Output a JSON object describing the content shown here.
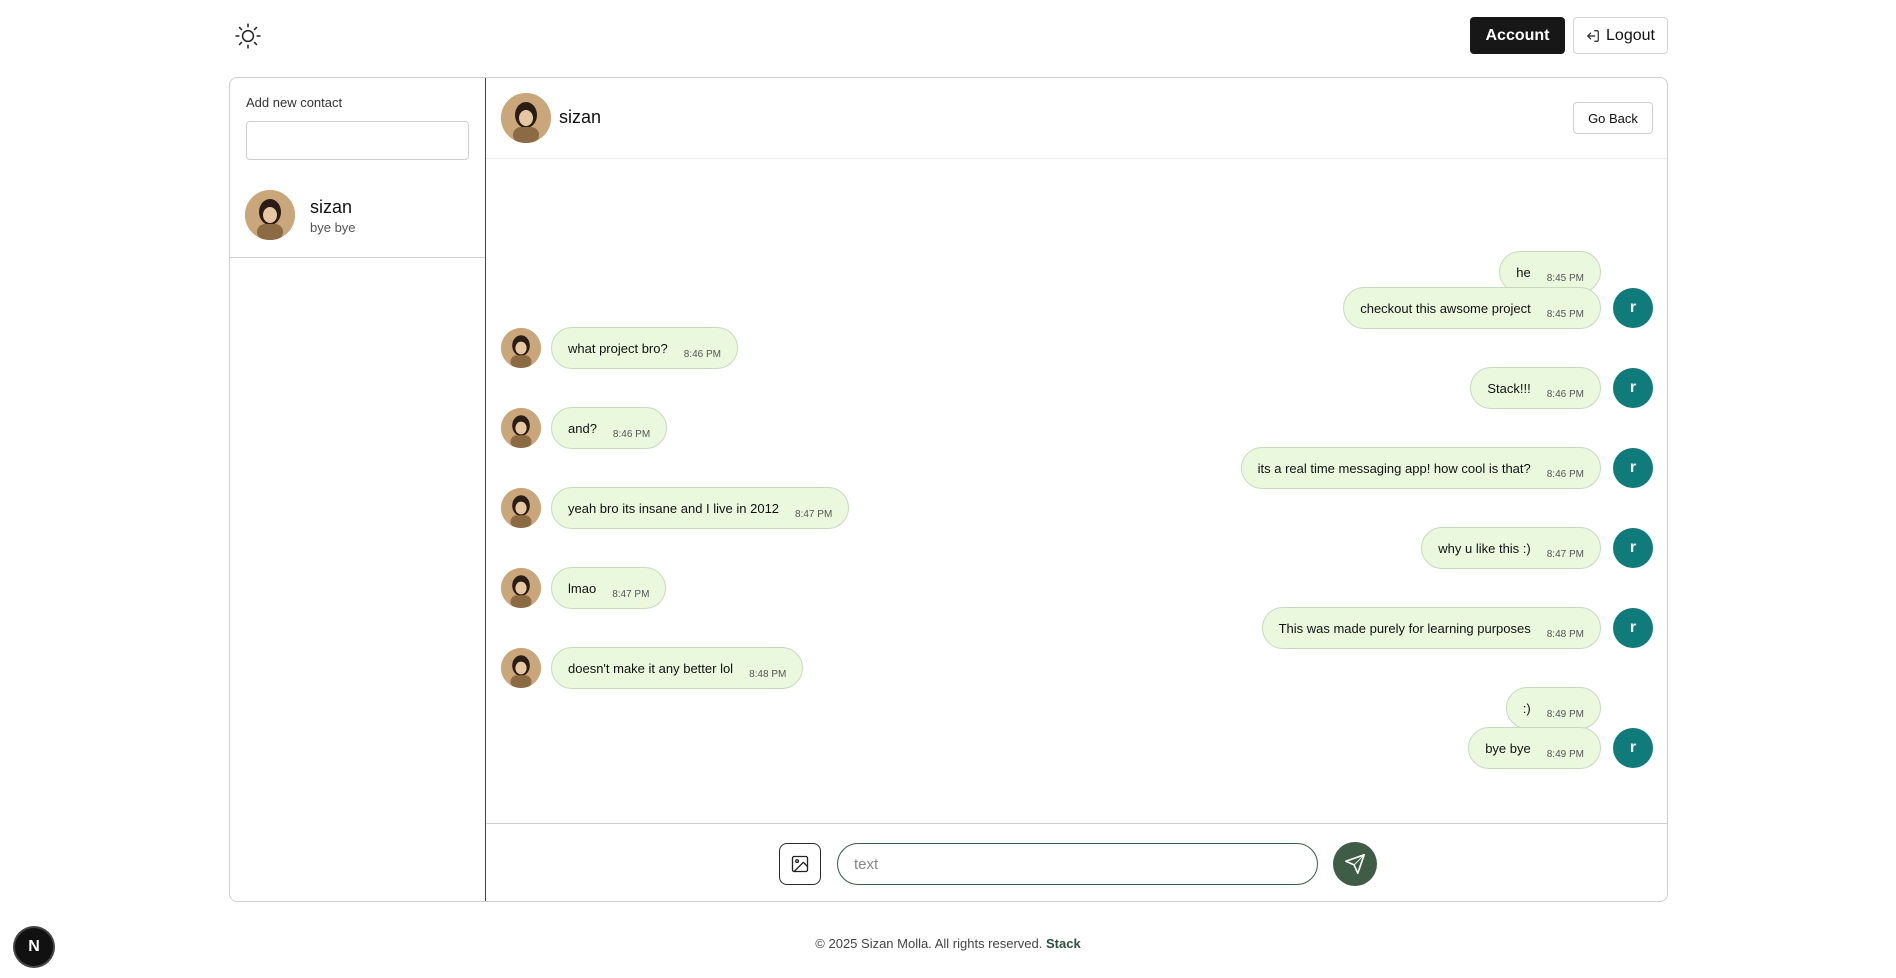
{
  "header": {
    "account_label": "Account",
    "logout_label": "Logout",
    "theme_icon": "sun-icon"
  },
  "sidebar": {
    "add_contact_label": "Add new contact",
    "add_contact_value": "",
    "contacts": [
      {
        "name": "sizan",
        "last_message": "bye bye"
      }
    ]
  },
  "chat": {
    "name": "sizan",
    "back_label": "Go Back",
    "input_placeholder": "text",
    "self_avatar_letter": "r",
    "accent_color": "#0f7c7b",
    "bubble_color": "#eaf9de",
    "send_color": "#3e5c46",
    "messages": [
      {
        "from": "me",
        "text": "he",
        "time": "8:45 PM"
      },
      {
        "from": "me",
        "text": "checkout this awsome project",
        "time": "8:45 PM"
      },
      {
        "from": "sizan",
        "text": "what project bro?",
        "time": "8:46 PM"
      },
      {
        "from": "me",
        "text": "Stack!!!",
        "time": "8:46 PM"
      },
      {
        "from": "sizan",
        "text": "and?",
        "time": "8:46 PM"
      },
      {
        "from": "me",
        "text": "its a real time messaging app! how cool is that?",
        "time": "8:46 PM"
      },
      {
        "from": "sizan",
        "text": "yeah bro its insane and I live in 2012",
        "time": "8:47 PM"
      },
      {
        "from": "me",
        "text": "why u like this :)",
        "time": "8:47 PM"
      },
      {
        "from": "sizan",
        "text": "lmao",
        "time": "8:47 PM"
      },
      {
        "from": "me",
        "text": "This was made purely for learning purposes",
        "time": "8:48 PM"
      },
      {
        "from": "sizan",
        "text": "doesn't make it any better lol",
        "time": "8:48 PM"
      },
      {
        "from": "me",
        "text": ":)",
        "time": "8:49 PM"
      },
      {
        "from": "me",
        "text": "bye bye",
        "time": "8:49 PM"
      }
    ]
  },
  "footer": {
    "copyright": "© 2025 Sizan Molla. All rights reserved.",
    "brand": "Stack"
  },
  "dev_badge": "N"
}
